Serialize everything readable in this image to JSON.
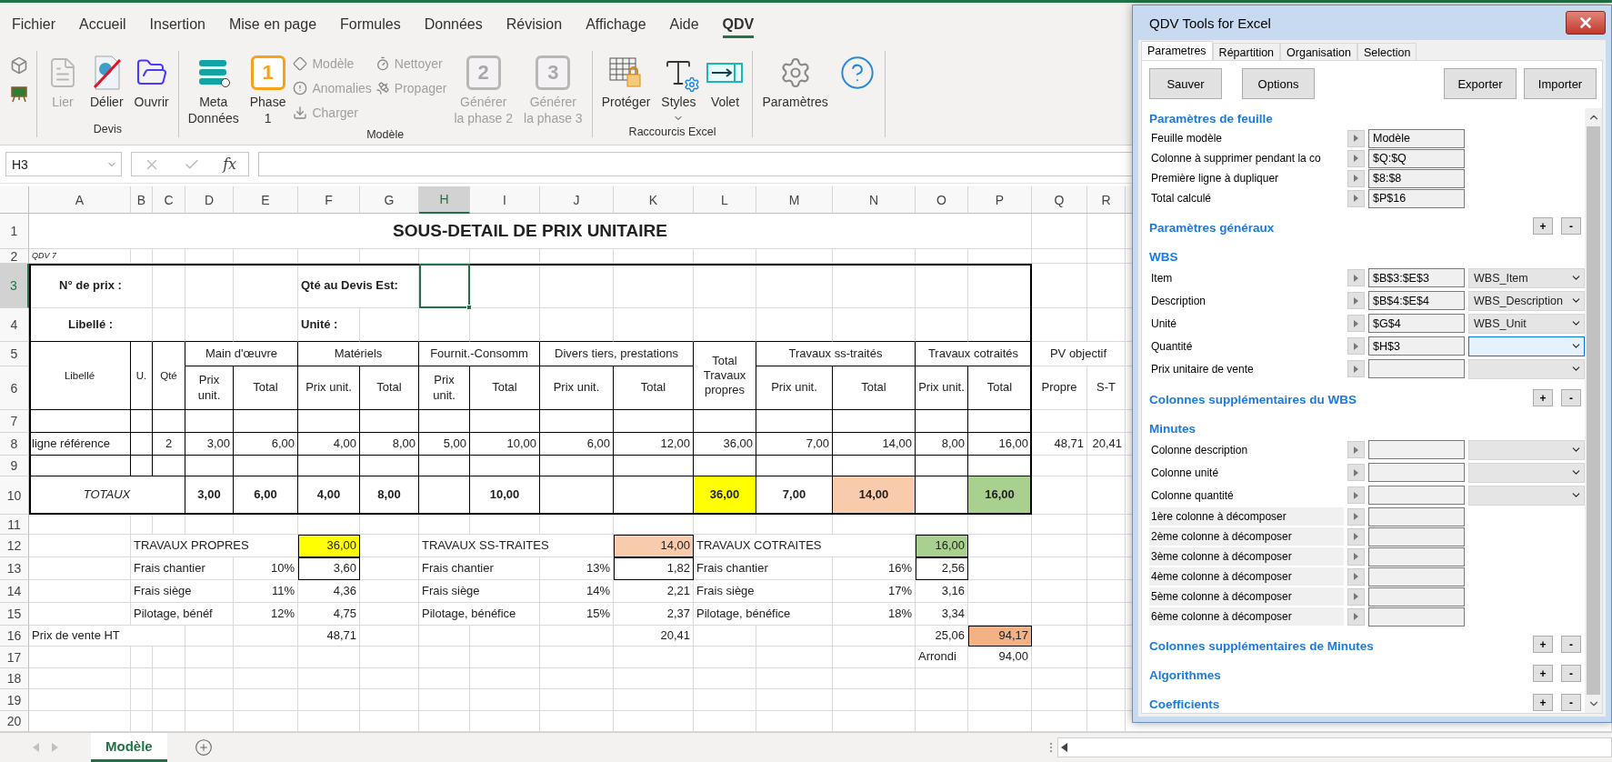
{
  "menu": [
    {
      "label": "Fichier",
      "selected": false
    },
    {
      "label": "Accueil",
      "selected": false
    },
    {
      "label": "Insertion",
      "selected": false
    },
    {
      "label": "Mise en page",
      "selected": false
    },
    {
      "label": "Formules",
      "selected": false
    },
    {
      "label": "Données",
      "selected": false
    },
    {
      "label": "Révision",
      "selected": false
    },
    {
      "label": "Affichage",
      "selected": false
    },
    {
      "label": "Aide",
      "selected": false
    },
    {
      "label": "QDV",
      "selected": true
    }
  ],
  "ribbon": {
    "groups": [
      {
        "buttons": [
          {
            "kind": "mini",
            "disabled": false
          },
          {
            "kind": "mini",
            "disabled": false
          }
        ]
      },
      {
        "label": "Devis",
        "buttons": [
          {
            "kind": "large",
            "label": "Lier",
            "disabled": true
          },
          {
            "kind": "large",
            "label": "Délier",
            "disabled": false
          },
          {
            "kind": "large",
            "label": "Ouvrir",
            "disabled": false
          }
        ]
      },
      {
        "label": "Modèle",
        "buttons": [
          {
            "kind": "large",
            "label": "Meta\nDonnées",
            "disabled": false
          },
          {
            "kind": "large",
            "label": "Phase\n1",
            "badge": "1",
            "disabled": false
          },
          {
            "kind": "small",
            "label": "Modèle",
            "disabled": true
          },
          {
            "kind": "small",
            "label": "Anomalies",
            "disabled": true
          },
          {
            "kind": "small",
            "label": "Charger",
            "disabled": true
          },
          {
            "kind": "small",
            "label": "Nettoyer",
            "disabled": true
          },
          {
            "kind": "small",
            "label": "Propager",
            "disabled": true
          },
          {
            "kind": "large",
            "label": "Générer\nla phase 2",
            "badge": "2",
            "disabled": true
          },
          {
            "kind": "large",
            "label": "Générer\nla phase 3",
            "badge": "3",
            "disabled": true
          }
        ]
      },
      {
        "label": "Raccourcis Excel",
        "buttons": [
          {
            "kind": "large",
            "label": "Protéger",
            "disabled": false
          },
          {
            "kind": "large-menu",
            "label": "Styles",
            "disabled": false
          },
          {
            "kind": "large",
            "label": "Volet",
            "disabled": false
          }
        ]
      },
      {
        "buttons": [
          {
            "kind": "large",
            "label": "Paramètres",
            "disabled": false
          },
          {
            "kind": "large",
            "disabled": false
          }
        ]
      }
    ]
  },
  "formula_bar": {
    "name_box": "H3",
    "function_label": "fx"
  },
  "sheet": {
    "columns": [
      {
        "label": "A",
        "selected": false
      },
      {
        "label": "B",
        "selected": false
      },
      {
        "label": "C",
        "selected": false
      },
      {
        "label": "D",
        "selected": false
      },
      {
        "label": "E",
        "selected": false
      },
      {
        "label": "F",
        "selected": false
      },
      {
        "label": "G",
        "selected": false
      },
      {
        "label": "H",
        "selected": true
      },
      {
        "label": "I",
        "selected": false
      },
      {
        "label": "J",
        "selected": false
      },
      {
        "label": "K",
        "selected": false
      },
      {
        "label": "L",
        "selected": false
      },
      {
        "label": "M",
        "selected": false
      },
      {
        "label": "N",
        "selected": false
      },
      {
        "label": "O",
        "selected": false
      },
      {
        "label": "P",
        "selected": false
      },
      {
        "label": "Q",
        "selected": false
      },
      {
        "label": "R",
        "selected": false
      }
    ],
    "rows": [
      {
        "label": "1",
        "selected": false
      },
      {
        "label": "2",
        "selected": false
      },
      {
        "label": "3",
        "selected": true
      },
      {
        "label": "4",
        "selected": false
      },
      {
        "label": "5",
        "selected": false
      },
      {
        "label": "6",
        "selected": false
      },
      {
        "label": "7",
        "selected": false
      },
      {
        "label": "8",
        "selected": false
      },
      {
        "label": "9",
        "selected": false
      },
      {
        "label": "10",
        "selected": false
      },
      {
        "label": "11",
        "selected": false
      },
      {
        "label": "12",
        "selected": false
      },
      {
        "label": "13",
        "selected": false
      },
      {
        "label": "14",
        "selected": false
      },
      {
        "label": "15",
        "selected": false
      },
      {
        "label": "16",
        "selected": false
      },
      {
        "label": "17",
        "selected": false
      },
      {
        "label": "18",
        "selected": false
      },
      {
        "label": "19",
        "selected": false
      },
      {
        "label": "20",
        "selected": false
      }
    ],
    "cells": [
      {
        "kind": "title",
        "text": "SOUS-DETAIL DE PRIX UNITAIRE"
      },
      {
        "kind": "note",
        "text": "QDV 7"
      },
      {
        "kind": "label-center",
        "text": "N° de prix :"
      },
      {
        "kind": "label",
        "text": "Qté au Devis Est:"
      },
      {
        "kind": "label-center",
        "text": "Libellé :"
      },
      {
        "kind": "label",
        "text": "Unité :"
      },
      {
        "kind": "caption",
        "text": "Libellé"
      },
      {
        "kind": "caption",
        "text": "U."
      },
      {
        "kind": "caption",
        "text": "Qté"
      },
      {
        "kind": "header",
        "text": "Main d'œuvre"
      },
      {
        "kind": "header",
        "text": "Matériels"
      },
      {
        "kind": "header",
        "text": "Fournit.-Consomm"
      },
      {
        "kind": "header",
        "text": "Divers tiers, prestations"
      },
      {
        "kind": "header",
        "text": "Total Travaux propres"
      },
      {
        "kind": "header",
        "text": "Travaux ss-traités"
      },
      {
        "kind": "header",
        "text": "Travaux cotraités"
      },
      {
        "kind": "header",
        "text": "PV objectif"
      },
      {
        "kind": "header",
        "text": "Prix unit."
      },
      {
        "kind": "header",
        "text": "Total"
      },
      {
        "kind": "header",
        "text": "Prix unit."
      },
      {
        "kind": "header",
        "text": "Total"
      },
      {
        "kind": "header",
        "text": "Prix unit."
      },
      {
        "kind": "header",
        "text": "Total"
      },
      {
        "kind": "header",
        "text": "Prix unit."
      },
      {
        "kind": "header",
        "text": "Total"
      },
      {
        "kind": "header",
        "text": "Prix unit."
      },
      {
        "kind": "header",
        "text": "Total"
      },
      {
        "kind": "header",
        "text": "Prix unit."
      },
      {
        "kind": "header",
        "text": "Total"
      },
      {
        "kind": "header",
        "text": "Propre"
      },
      {
        "kind": "header",
        "text": "S-T"
      },
      {
        "kind": "text",
        "text": "ligne référence"
      },
      {
        "kind": "center",
        "text": "2"
      },
      {
        "kind": "number",
        "text": "3,00"
      },
      {
        "kind": "number",
        "text": "6,00"
      },
      {
        "kind": "number",
        "text": "4,00"
      },
      {
        "kind": "number",
        "text": "8,00"
      },
      {
        "kind": "number",
        "text": "5,00"
      },
      {
        "kind": "number",
        "text": "10,00"
      },
      {
        "kind": "number",
        "text": "6,00"
      },
      {
        "kind": "number",
        "text": "12,00"
      },
      {
        "kind": "number",
        "text": "36,00"
      },
      {
        "kind": "number",
        "text": "7,00"
      },
      {
        "kind": "number",
        "text": "14,00"
      },
      {
        "kind": "number",
        "text": "8,00"
      },
      {
        "kind": "number",
        "text": "16,00"
      },
      {
        "kind": "number",
        "text": "48,71"
      },
      {
        "kind": "number",
        "text": "20,41"
      },
      {
        "kind": "italic",
        "text": "TOTAUX"
      },
      {
        "kind": "total",
        "text": "3,00"
      },
      {
        "kind": "total",
        "text": "6,00"
      },
      {
        "kind": "total",
        "text": "4,00"
      },
      {
        "kind": "total",
        "text": "8,00"
      },
      {
        "kind": "total",
        "text": "10,00"
      },
      {
        "kind": "total",
        "text": "36,00",
        "color": "#ffff00"
      },
      {
        "kind": "total",
        "text": "7,00"
      },
      {
        "kind": "total",
        "text": "14,00",
        "color": "#f8cbad"
      },
      {
        "kind": "total",
        "text": "16,00",
        "color": "#a9d08e"
      },
      {
        "kind": "text",
        "text": "TRAVAUX PROPRES"
      },
      {
        "kind": "boxed",
        "text": "36,00",
        "color": "#ffff00"
      },
      {
        "kind": "text",
        "text": "TRAVAUX SS-TRAITES"
      },
      {
        "kind": "boxed",
        "text": "14,00",
        "color": "#f8cbad"
      },
      {
        "kind": "text",
        "text": "TRAVAUX COTRAITES"
      },
      {
        "kind": "boxed",
        "text": "16,00",
        "color": "#a9d08e"
      },
      {
        "kind": "text",
        "text": "Frais chantier"
      },
      {
        "kind": "number",
        "text": "10%"
      },
      {
        "kind": "boxed",
        "text": "3,60"
      },
      {
        "kind": "text",
        "text": "Frais chantier"
      },
      {
        "kind": "number",
        "text": "13%"
      },
      {
        "kind": "boxed",
        "text": "1,82"
      },
      {
        "kind": "text",
        "text": "Frais chantier"
      },
      {
        "kind": "number",
        "text": "16%"
      },
      {
        "kind": "boxed",
        "text": "2,56"
      },
      {
        "kind": "text",
        "text": "Frais siège"
      },
      {
        "kind": "number",
        "text": "11%"
      },
      {
        "kind": "number",
        "text": "4,36"
      },
      {
        "kind": "text",
        "text": "Frais siège"
      },
      {
        "kind": "number",
        "text": "14%"
      },
      {
        "kind": "number",
        "text": "2,21"
      },
      {
        "kind": "text",
        "text": "Frais siège"
      },
      {
        "kind": "number",
        "text": "17%"
      },
      {
        "kind": "number",
        "text": "3,16"
      },
      {
        "kind": "text",
        "text": "Pilotage, bénéf"
      },
      {
        "kind": "number",
        "text": "12%"
      },
      {
        "kind": "number",
        "text": "4,75"
      },
      {
        "kind": "text",
        "text": "Pilotage, bénéfice"
      },
      {
        "kind": "number",
        "text": "15%"
      },
      {
        "kind": "number",
        "text": "2,37"
      },
      {
        "kind": "text",
        "text": "Pilotage, bénéfice"
      },
      {
        "kind": "number",
        "text": "18%"
      },
      {
        "kind": "number",
        "text": "3,34"
      },
      {
        "kind": "text",
        "text": "Prix de vente HT"
      },
      {
        "kind": "number",
        "text": "48,71"
      },
      {
        "kind": "number",
        "text": "20,41"
      },
      {
        "kind": "number",
        "text": "25,06"
      },
      {
        "kind": "boxed",
        "text": "94,17",
        "color": "#f4b183"
      },
      {
        "kind": "text",
        "text": "Arrondi"
      },
      {
        "kind": "number",
        "text": "94,00"
      }
    ]
  },
  "sheet_tabs": [
    {
      "label": "Modèle",
      "selected": true
    }
  ],
  "panel": {
    "title": "QDV Tools for Excel",
    "tabs": [
      {
        "label": "Parametres",
        "selected": true
      },
      {
        "label": "Répartition",
        "selected": false
      },
      {
        "label": "Organisation",
        "selected": false
      },
      {
        "label": "Selection",
        "selected": false
      }
    ],
    "buttons": [
      "Sauver",
      "Options",
      "Exporter",
      "Importer"
    ],
    "items": [
      {
        "kind": "heading",
        "title": "Paramètres de feuille"
      },
      {
        "kind": "field",
        "label": "Feuille modèle",
        "value": "Modèle"
      },
      {
        "kind": "field",
        "label": "Colonne à supprimer pendant la co",
        "value": "$Q:$Q"
      },
      {
        "kind": "field",
        "label": "Première ligne à dupliquer",
        "value": "$8:$8"
      },
      {
        "kind": "field",
        "label": "Total calculé",
        "value": "$P$16"
      },
      {
        "kind": "heading",
        "title": "Paramètres généraux",
        "controls": [
          "+",
          "-"
        ]
      },
      {
        "kind": "heading",
        "title": "WBS"
      },
      {
        "kind": "select",
        "label": "Item",
        "value": "$B$3:$E$3",
        "choice": "WBS_Item",
        "focused": false
      },
      {
        "kind": "select",
        "label": "Description",
        "value": "$B$4:$E$4",
        "choice": "WBS_Description",
        "focused": false
      },
      {
        "kind": "select",
        "label": "Unité",
        "value": "$G$4",
        "choice": "WBS_Unit",
        "focused": false
      },
      {
        "kind": "select",
        "label": "Quantité",
        "value": "$H$3",
        "focused": true
      },
      {
        "kind": "select",
        "label": "Prix unitaire de vente",
        "focused": false
      },
      {
        "kind": "heading",
        "title": "Colonnes supplémentaires du WBS",
        "controls": [
          "+",
          "-"
        ]
      },
      {
        "kind": "heading",
        "title": "Minutes"
      },
      {
        "kind": "select",
        "label": "Colonne description",
        "focused": false
      },
      {
        "kind": "select",
        "label": "Colonne unité",
        "focused": false
      },
      {
        "kind": "select",
        "label": "Colonne quantité",
        "focused": false
      },
      {
        "kind": "shaded",
        "label": "1ère colonne à décomposer"
      },
      {
        "kind": "shaded",
        "label": "2ème colonne à décomposer"
      },
      {
        "kind": "shaded",
        "label": "3ème colonne à décomposer"
      },
      {
        "kind": "shaded",
        "label": "4ème colonne à décomposer"
      },
      {
        "kind": "shaded",
        "label": "5ème colonne à décomposer"
      },
      {
        "kind": "shaded",
        "label": "6ème colonne à décomposer"
      },
      {
        "kind": "heading",
        "title": "Colonnes supplémentaires de Minutes",
        "controls": [
          "+",
          "-"
        ]
      },
      {
        "kind": "heading",
        "title": "Algorithmes",
        "controls": [
          "+",
          "-"
        ]
      },
      {
        "kind": "heading",
        "title": "Coefficients",
        "controls": [
          "+",
          "-"
        ]
      }
    ]
  }
}
